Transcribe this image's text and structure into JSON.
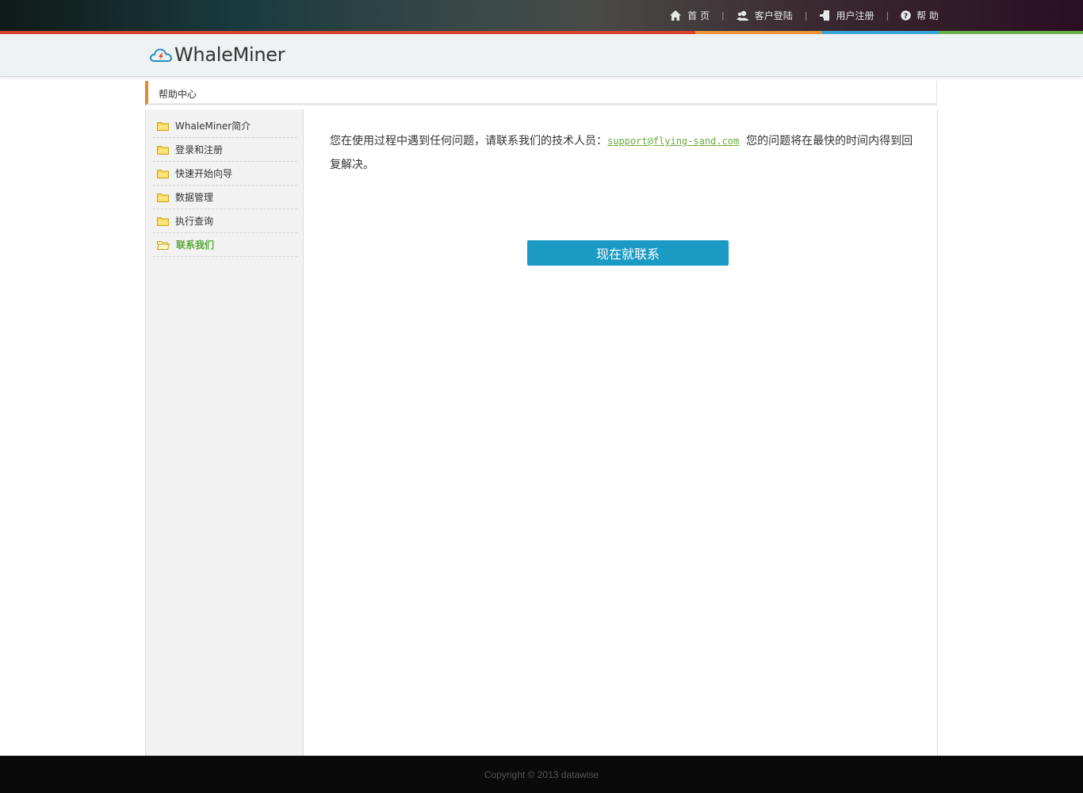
{
  "topnav": {
    "items": [
      {
        "label": "首 页",
        "icon": "home-icon"
      },
      {
        "label": "客户登陆",
        "icon": "user-login-icon"
      },
      {
        "label": "用户注册",
        "icon": "register-icon"
      },
      {
        "label": "帮 助",
        "icon": "help-icon"
      }
    ],
    "separator": "|"
  },
  "brand": {
    "name": "WhaleMiner",
    "logo_icon": "cloud-lightning-icon"
  },
  "breadcrumb": {
    "title": "帮助中心"
  },
  "sidebar": {
    "items": [
      {
        "label": "WhaleMiner简介",
        "icon": "folder-icon",
        "active": false
      },
      {
        "label": "登录和注册",
        "icon": "folder-icon",
        "active": false
      },
      {
        "label": "快速开始向导",
        "icon": "folder-icon",
        "active": false
      },
      {
        "label": "数据管理",
        "icon": "folder-icon",
        "active": false
      },
      {
        "label": "执行查询",
        "icon": "folder-icon",
        "active": false
      },
      {
        "label": "联系我们",
        "icon": "folder-open-icon",
        "active": true
      }
    ]
  },
  "content": {
    "text_before": "您在使用过程中遇到任何问题，请联系我们的技术人员：",
    "email": "support@flying-sand.com",
    "text_after": "  您的问题将在最快的时间内得到回复解决。",
    "button_label": "现在就联系"
  },
  "footer": {
    "copyright": "Copyright © 2013 datawise"
  },
  "colors": {
    "accent_orange": "#e08a2c",
    "link_green": "#6aaa3a",
    "button_blue": "#1b9bc4",
    "stripe_red": "#d9432b",
    "stripe_orange": "#e8923a",
    "stripe_blue": "#3aa7d8",
    "stripe_green": "#6ab04a"
  }
}
